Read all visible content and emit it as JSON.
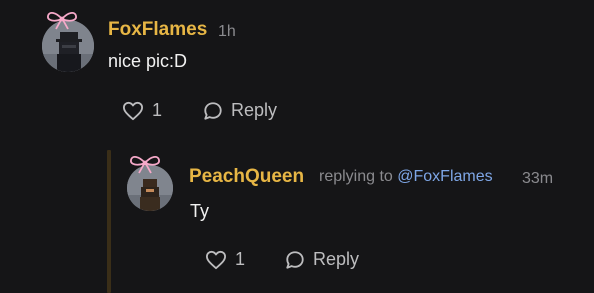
{
  "comments": [
    {
      "username": "FoxFlames",
      "time": "1h",
      "text": "nice pic:D",
      "likes": "1",
      "reply_label": "Reply"
    },
    {
      "username": "PeachQueen",
      "replying_prefix": "replying to ",
      "replying_to": "@FoxFlames",
      "time": "33m",
      "text": "Ty",
      "likes": "1",
      "reply_label": "Reply"
    }
  ],
  "colors": {
    "background": "#151517",
    "username": "#e7b645",
    "mention": "#7ea6e6",
    "muted": "#8a8a8e",
    "thread_line": "#3a2e18"
  },
  "icons": [
    "pink-bow-icon",
    "heart-icon",
    "speech-bubble-icon",
    "avatar-image"
  ]
}
